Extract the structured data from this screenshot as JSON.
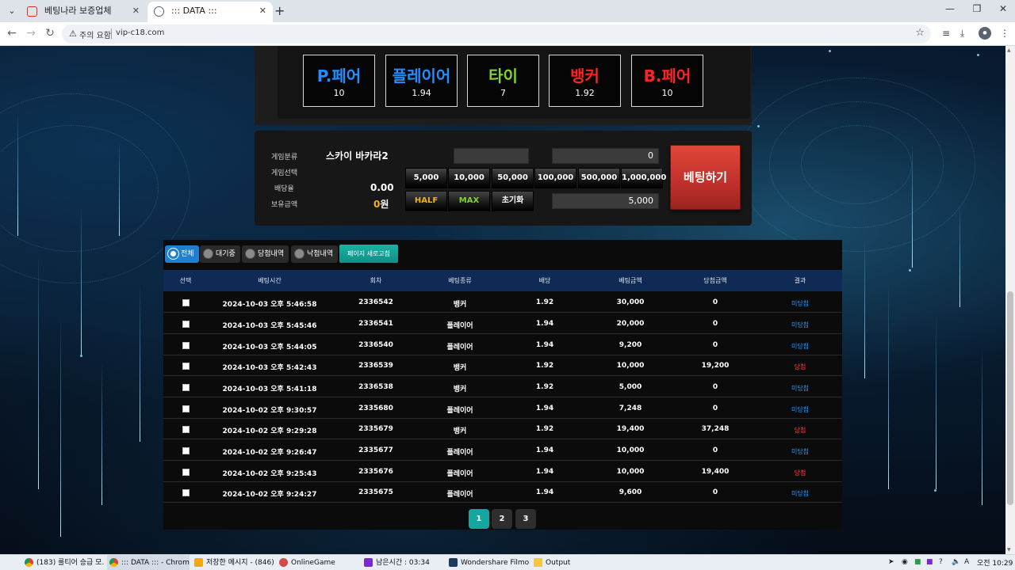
{
  "browser": {
    "tabs": [
      {
        "title": "베팅나라 보증업체",
        "active": false
      },
      {
        "title": "::: DATA :::",
        "active": true
      }
    ],
    "warning": "주의 요함",
    "url": "vip-c18.com"
  },
  "options": [
    {
      "name": "P.페어",
      "odds": "10",
      "color": "#1e90ff"
    },
    {
      "name": "플레이어",
      "odds": "1.94",
      "color": "#1e90ff"
    },
    {
      "name": "타이",
      "odds": "7",
      "color": "#7fd62a"
    },
    {
      "name": "뱅커",
      "odds": "1.92",
      "color": "#ff2222"
    },
    {
      "name": "B.페어",
      "odds": "10",
      "color": "#ff2222"
    }
  ],
  "control": {
    "labels": [
      "게임분류",
      "게임선택",
      "배당율",
      "보유금액"
    ],
    "game_name": "스카이 바카라2",
    "odds_value": "0.00",
    "balance_value": "0",
    "balance_unit": "원",
    "input_top_right": "0",
    "input_bottom": "5,000",
    "chips": [
      "5,000",
      "10,000",
      "50,000",
      "100,000",
      "500,000",
      "1,000,000"
    ],
    "half": "HALF",
    "max": "MAX",
    "reset": "초기화",
    "bet_button": "베팅하기"
  },
  "filters": [
    {
      "label": "전체",
      "on": true
    },
    {
      "label": "대기중",
      "on": false
    },
    {
      "label": "당첨내역",
      "on": false
    },
    {
      "label": "낙첨내역",
      "on": false
    }
  ],
  "refresh_label": "페이지 새로고침",
  "table": {
    "headers": [
      "선택",
      "베팅시간",
      "회차",
      "베팅종류",
      "배당",
      "베팅금액",
      "당첨금액",
      "결과"
    ],
    "rows": [
      [
        "2024-10-03 오후 5:46:58",
        "2336542",
        "뱅커",
        "1.92",
        "30,000",
        "0",
        "미당첨"
      ],
      [
        "2024-10-03 오후 5:45:46",
        "2336541",
        "플레이어",
        "1.94",
        "20,000",
        "0",
        "미당첨"
      ],
      [
        "2024-10-03 오후 5:44:05",
        "2336540",
        "플레이어",
        "1.94",
        "9,200",
        "0",
        "미당첨"
      ],
      [
        "2024-10-03 오후 5:42:43",
        "2336539",
        "뱅커",
        "1.92",
        "10,000",
        "19,200",
        "당첨"
      ],
      [
        "2024-10-03 오후 5:41:18",
        "2336538",
        "뱅커",
        "1.92",
        "5,000",
        "0",
        "미당첨"
      ],
      [
        "2024-10-02 오후 9:30:57",
        "2335680",
        "플레이어",
        "1.94",
        "7,248",
        "0",
        "미당첨"
      ],
      [
        "2024-10-02 오후 9:29:28",
        "2335679",
        "뱅커",
        "1.92",
        "19,400",
        "37,248",
        "당첨"
      ],
      [
        "2024-10-02 오후 9:26:47",
        "2335677",
        "플레이어",
        "1.94",
        "10,000",
        "0",
        "미당첨"
      ],
      [
        "2024-10-02 오후 9:25:43",
        "2335676",
        "플레이어",
        "1.94",
        "10,000",
        "19,400",
        "당첨"
      ],
      [
        "2024-10-02 오후 9:24:27",
        "2335675",
        "플레이어",
        "1.94",
        "9,600",
        "0",
        "미당첨"
      ]
    ]
  },
  "pages": [
    "1",
    "2",
    "3"
  ],
  "taskbar": {
    "items": [
      "(183) 룰티어 승급 모...",
      "::: DATA ::: - Chrome",
      "저장한 메시지 - (846)",
      "OnlineGame",
      "남은시간 : 03:34",
      "Wondershare Filmora",
      "Output"
    ],
    "clock": "오전 10:29"
  }
}
